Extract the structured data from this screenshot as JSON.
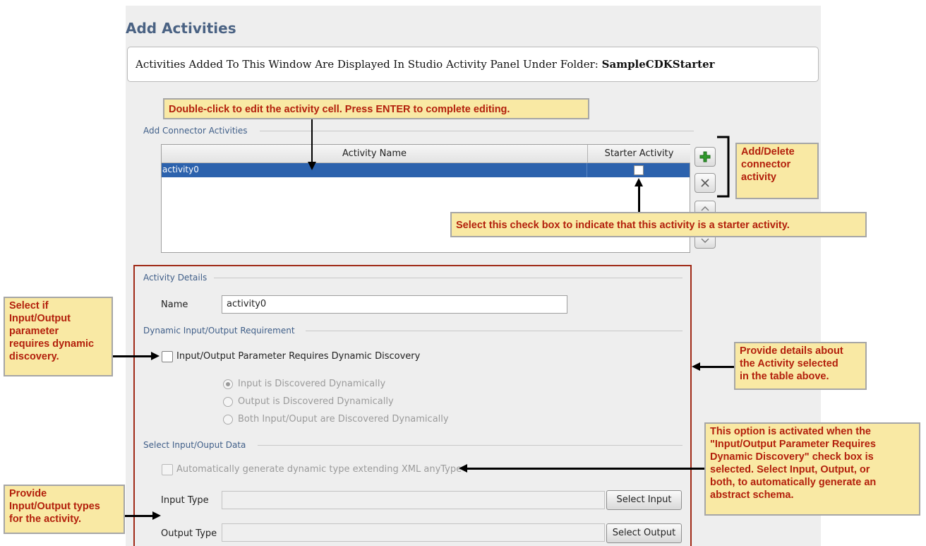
{
  "page": {
    "title": "Add Activities"
  },
  "info": {
    "prefix": "Activities Added To This Window Are Displayed In Studio Activity Panel Under Folder:",
    "folder": "SampleCDKStarter"
  },
  "connector_section": {
    "label": "Add Connector Activities",
    "columns": [
      "Activity Name",
      "Starter Activity"
    ],
    "rows": [
      {
        "activity_name": "activity0",
        "starter": false,
        "selected": true
      }
    ],
    "buttons": {
      "add": "add-icon",
      "delete": "delete-icon",
      "up": "chevron-up-icon",
      "down": "chevron-down-icon"
    }
  },
  "details": {
    "label": "Activity Details",
    "name_label": "Name",
    "name_value": "activity0",
    "dynamic_section_label": "Dynamic Input/Output Requirement",
    "dynamic_checkbox_label": "Input/Output Parameter Requires Dynamic Discovery",
    "radio_options": [
      "Input is Discovered Dynamically",
      "Output is Discovered Dynamically",
      "Both Input/Ouput are Discovered Dynamically"
    ],
    "select_section_label": "Select Input/Ouput Data",
    "auto_generate_label": "Automatically generate dynamic type extending XML anyType",
    "input_type_label": "Input Type",
    "input_type_value": "",
    "select_input_button": "Select Input",
    "output_type_label": "Output Type",
    "output_type_value": "",
    "select_output_button": "Select Output"
  },
  "callouts": {
    "edit_cell": "Double-click to edit the activity cell. Press ENTER to complete editing.",
    "add_delete": [
      "Add/Delete",
      "connector",
      "activity"
    ],
    "starter_check": "Select this check box to indicate that this activity is a starter activity.",
    "dynamic": [
      "Select if",
      "Input/Output",
      "parameter",
      "requires dynamic",
      "discovery."
    ],
    "details": [
      "Provide details about",
      "the Activity selected",
      "in the table above."
    ],
    "option": [
      "This option is activated when the",
      "\"Input/Output Parameter Requires",
      "Dynamic Discovery\" check box is",
      "selected. Select Input, Output, or",
      "both, to automatically generate an",
      "abstract schema."
    ],
    "types": [
      "Provide",
      "Input/Output types",
      "for the activity."
    ]
  },
  "colors": {
    "accent": "#2c62ad",
    "callout_bg": "#f9e9a4",
    "callout_text": "#b3200c",
    "frame": "#a02a17"
  }
}
